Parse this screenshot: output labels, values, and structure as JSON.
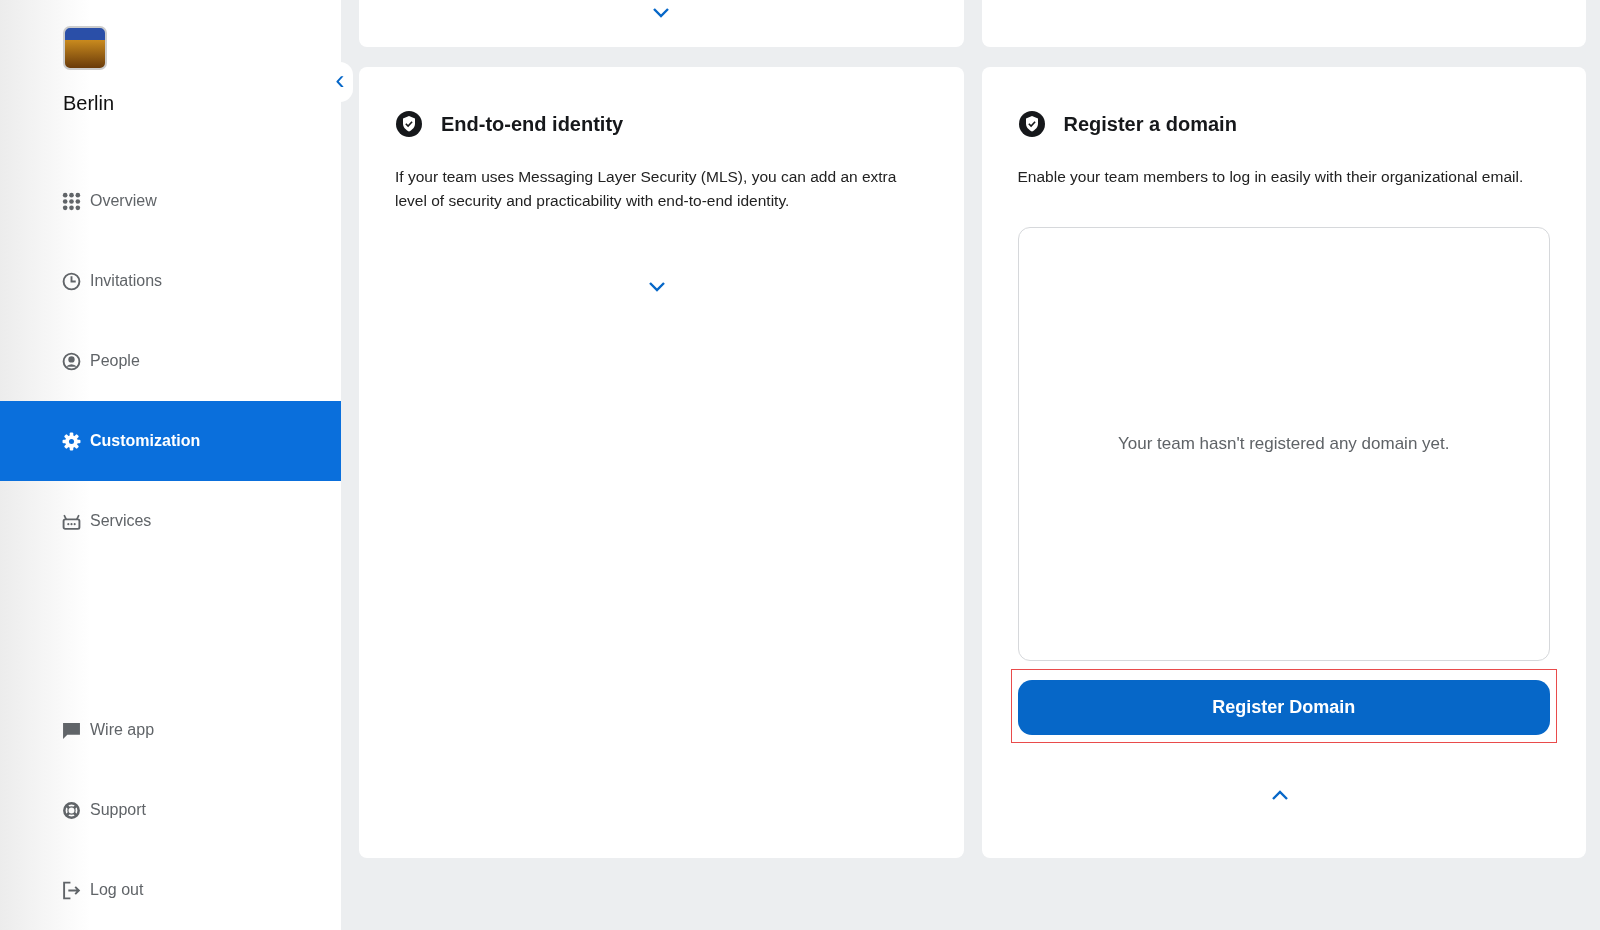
{
  "sidebar": {
    "team_name": "Berlin",
    "collapse_button": "‹",
    "nav_items": [
      {
        "label": "Overview",
        "kind": "grid",
        "selected": false
      },
      {
        "label": "Invitations",
        "kind": "clock",
        "selected": false
      },
      {
        "label": "People",
        "kind": "person",
        "selected": false
      },
      {
        "label": "Customization",
        "kind": "gear",
        "selected": true
      },
      {
        "label": "Services",
        "kind": "bot",
        "selected": false
      }
    ],
    "bottom_items": [
      {
        "label": "Wire app",
        "kind": "chat"
      },
      {
        "label": "Support",
        "kind": "lifebuoy"
      },
      {
        "label": "Log out",
        "kind": "logout"
      }
    ]
  },
  "top_cards": [
    {
      "expanded": false
    }
  ],
  "cards": [
    {
      "title": "End-to-end identity",
      "description": "If your team uses Messaging Layer Security (MLS), you can add an extra level of security and practicability with end-to-end identity.",
      "expanded": false
    },
    {
      "title": "Register a domain",
      "description": "Enable your team members to log in easily with their organizational email.",
      "expanded": true,
      "empty_message": "Your team hasn't registered any domain yet.",
      "button": {
        "label": "Register Domain",
        "highlighted": true
      }
    }
  ]
}
